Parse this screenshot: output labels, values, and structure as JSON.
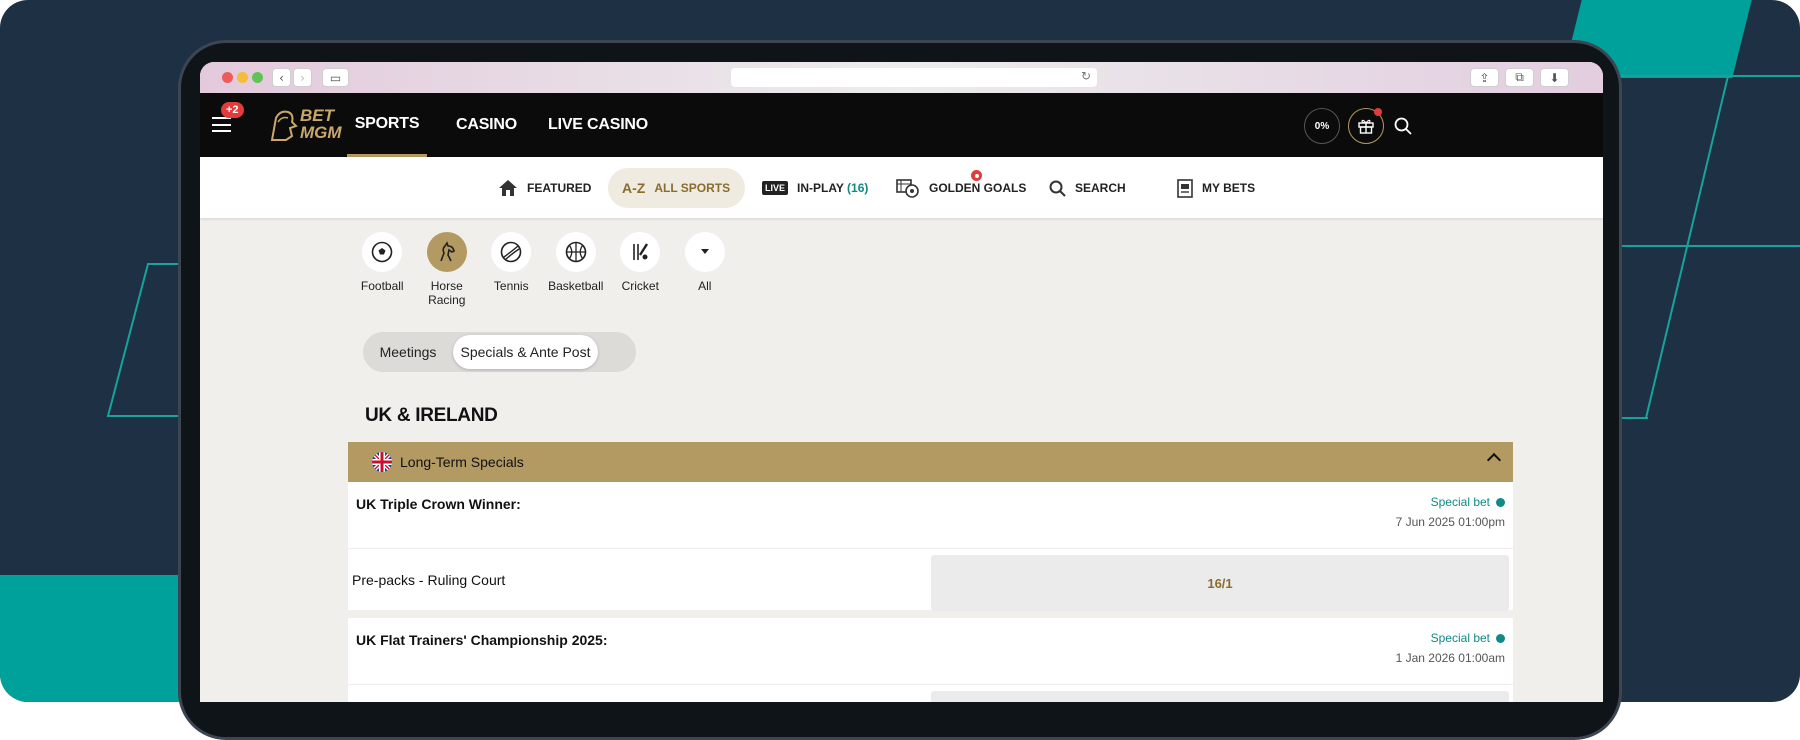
{
  "browser": {
    "url": ""
  },
  "topnav": {
    "notif_count": "+2",
    "logo_line1": "BET",
    "logo_line2": "MGM",
    "tabs": [
      {
        "label": "SPORTS",
        "active": true
      },
      {
        "label": "CASINO",
        "active": false
      },
      {
        "label": "LIVE CASINO",
        "active": false
      }
    ],
    "progress_label": "0%"
  },
  "subnav": {
    "items": [
      {
        "label": "FEATURED",
        "icon": "home-icon"
      },
      {
        "prefix": "A-Z",
        "label": "ALL SPORTS",
        "active": true
      },
      {
        "tag": "LIVE",
        "label": "IN-PLAY",
        "count": "(16)"
      },
      {
        "label": "GOLDEN GOALS",
        "icon": "golden-goals-icon"
      },
      {
        "label": "SEARCH",
        "icon": "search-icon"
      },
      {
        "label": "MY BETS",
        "icon": "betslip-icon"
      }
    ]
  },
  "sports": [
    {
      "label": "Football",
      "icon": "football-icon"
    },
    {
      "label": "Horse Racing",
      "icon": "horse-icon",
      "active": true
    },
    {
      "label": "Tennis",
      "icon": "tennis-icon"
    },
    {
      "label": "Basketball",
      "icon": "basketball-icon"
    },
    {
      "label": "Cricket",
      "icon": "cricket-icon"
    },
    {
      "label": "All",
      "icon": "chevron-down-icon"
    }
  ],
  "segment": {
    "options": [
      "Meetings",
      "Specials & Ante Post"
    ],
    "active": 1
  },
  "region": "UK & IRELAND",
  "section": {
    "title": "Long-Term Specials",
    "markets": [
      {
        "name": "UK Triple Crown Winner:",
        "type": "Special bet",
        "date": "7 Jun 2025 01:00pm",
        "selections": [
          {
            "name": "Pre-packs - Ruling Court",
            "odds": "16/1"
          }
        ]
      },
      {
        "name": "UK Flat Trainers' Championship 2025:",
        "type": "Special bet",
        "date": "1 Jan 2026 01:00am",
        "selections": []
      }
    ]
  },
  "colors": {
    "gold": "#b39962",
    "teal": "#108a87",
    "navy": "#1e3144",
    "accent_teal": "#00a19a"
  }
}
